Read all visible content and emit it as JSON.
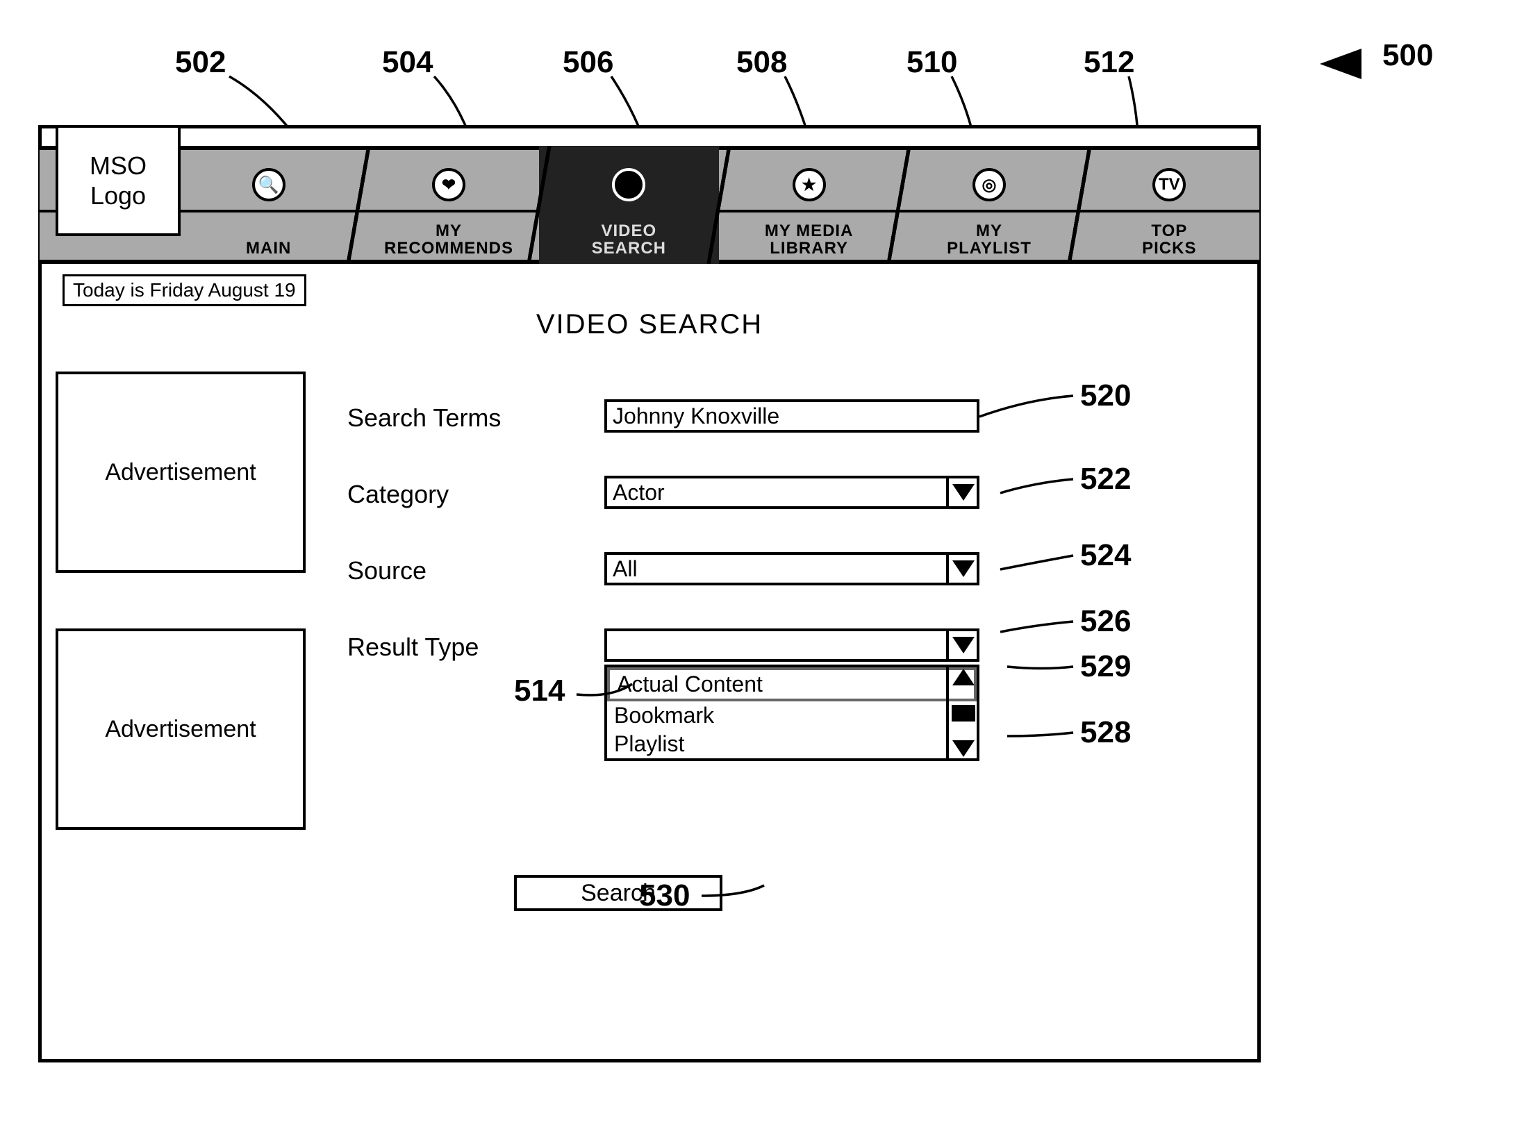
{
  "logo_text": "MSO\nLogo",
  "date_text": "Today is Friday August 19",
  "page_title": "VIDEO SEARCH",
  "nav": [
    {
      "label": "MAIN",
      "icon": "🔍",
      "active": false
    },
    {
      "label": "MY\nRECOMMENDS",
      "icon": "❤",
      "active": false
    },
    {
      "label": "VIDEO\nSEARCH",
      "icon": "●",
      "active": true
    },
    {
      "label": "MY MEDIA\nLIBRARY",
      "icon": "★",
      "active": false
    },
    {
      "label": "MY\nPLAYLIST",
      "icon": "◎",
      "active": false
    },
    {
      "label": "TOP\nPICKS",
      "icon": "TV",
      "active": false
    }
  ],
  "ads": {
    "slot1": "Advertisement",
    "slot2": "Advertisement"
  },
  "form": {
    "search_terms": {
      "label": "Search Terms",
      "value": "Johnny Knoxville"
    },
    "category": {
      "label": "Category",
      "value": "Actor"
    },
    "source": {
      "label": "Source",
      "value": "All"
    },
    "result_type": {
      "label": "Result Type",
      "value": "",
      "options": [
        "Actual Content",
        "Bookmark",
        "Playlist"
      ],
      "selected_index": 0
    },
    "search_button": "Search"
  },
  "refs": {
    "r500": "500",
    "r502": "502",
    "r504": "504",
    "r506": "506",
    "r508": "508",
    "r510": "510",
    "r512": "512",
    "r514": "514",
    "r520": "520",
    "r522": "522",
    "r524": "524",
    "r526": "526",
    "r528": "528",
    "r529": "529",
    "r530": "530"
  }
}
